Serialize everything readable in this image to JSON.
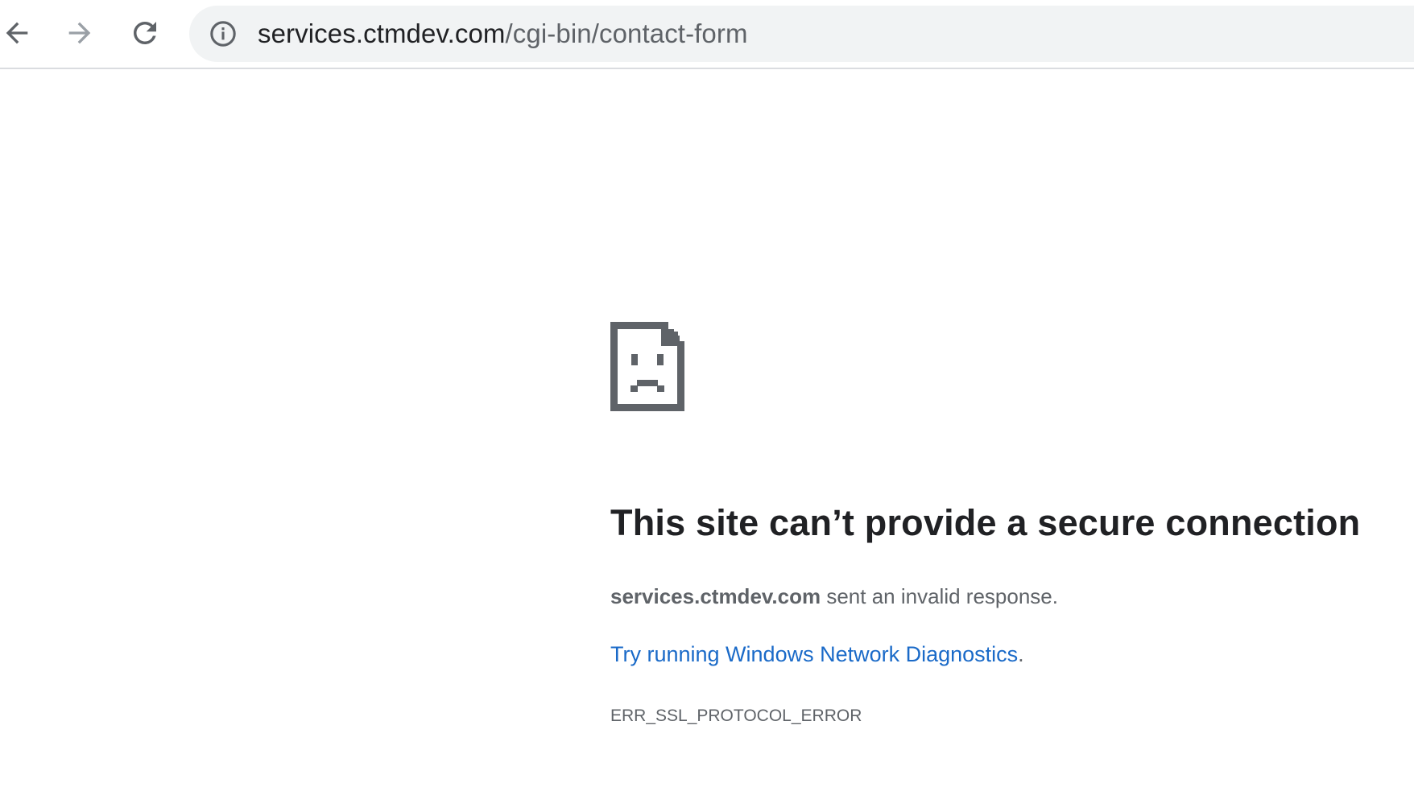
{
  "toolbar": {
    "back_icon": "back-arrow-icon",
    "forward_icon": "forward-arrow-icon",
    "reload_icon": "reload-icon",
    "info_icon": "info-icon"
  },
  "omnibox": {
    "host": "services.ctmdev.com",
    "path": "/cgi-bin/contact-form"
  },
  "error": {
    "icon": "sad-document-icon",
    "title": "This site can’t provide a secure connection",
    "host": "services.ctmdev.com",
    "message": " sent an invalid response.",
    "diagnostics_link": "Try running Windows Network Diagnostics",
    "diagnostics_period": ".",
    "code": "ERR_SSL_PROTOCOL_ERROR"
  },
  "colors": {
    "link": "#1a73e8",
    "text": "#202124",
    "secondary": "#5f6368",
    "omnibox_bg": "#f1f3f4"
  }
}
